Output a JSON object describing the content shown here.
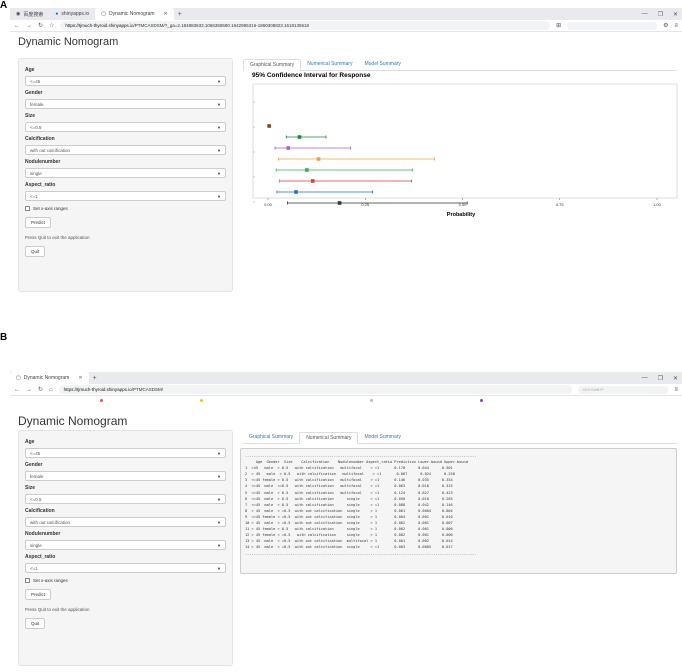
{
  "panels": {
    "a": "A",
    "b": "B"
  },
  "browser_a": {
    "tabs": [
      {
        "label": "百度搜索"
      },
      {
        "label": "shinyapps.io"
      },
      {
        "label": "Dynamic Nomogram"
      }
    ],
    "url_host": "https://tjmuch-thyroid.shinyapps.io",
    "url_path": "/PTMCASDSM/?_ga=2.184883633.1066359580.1642995316-1860308823.1618135618"
  },
  "browser_b": {
    "tabs": [
      {
        "label": "Dynamic Nomogram"
      }
    ],
    "url_host": "https://tjmuch-thyroid.shinyapps.io",
    "url_path": "/PTMCASDSM/",
    "search_placeholder": "Ctrl+Shift+F"
  },
  "app": {
    "title": "Dynamic Nomogram",
    "fields": [
      {
        "label": "Age",
        "value": "<=45"
      },
      {
        "label": "Gender",
        "value": "female"
      },
      {
        "label": "Size",
        "value": "<=0.5"
      },
      {
        "label": "Calcification",
        "value": "with out calcification"
      },
      {
        "label": "Nodulenumber",
        "value": "single"
      },
      {
        "label": "Aspect_ratio",
        "value": "<=1"
      }
    ],
    "checkbox_label": "Set x-axis ranges",
    "predict": "Predict",
    "quit_note": "Press Quit to exit the application",
    "quit": "Quit",
    "tabs": [
      "Graphical Summary",
      "Numerical Summary",
      "Model Summary"
    ]
  },
  "chart_data": {
    "type": "scatter",
    "title": "95% Confidence Interval for Response",
    "xlabel": "Probability",
    "xlim": [
      0,
      1
    ],
    "xticks": [
      "0.00",
      "0.25",
      "0.50",
      "0.75",
      "1.00"
    ],
    "colors": [
      "#8b4513",
      "#1a8a3a",
      "#b05cc8",
      "#f0a040",
      "#33b050",
      "#e03a3a",
      "#1f6fd0",
      "#333333"
    ],
    "series": [
      {
        "y": 1,
        "est": 0.003,
        "lo": 0.003,
        "hi": 0.003
      },
      {
        "y": 2,
        "est": 0.081,
        "lo": 0.047,
        "hi": 0.149
      },
      {
        "y": 3,
        "est": 0.052,
        "lo": 0.018,
        "hi": 0.212
      },
      {
        "y": 4,
        "est": 0.13,
        "lo": 0.027,
        "hi": 0.428
      },
      {
        "y": 5,
        "est": 0.1,
        "lo": 0.021,
        "hi": 0.371
      },
      {
        "y": 6,
        "est": 0.115,
        "lo": 0.03,
        "hi": 0.369
      },
      {
        "y": 7,
        "est": 0.072,
        "lo": 0.023,
        "hi": 0.269
      },
      {
        "y": 8,
        "est": 0.184,
        "lo": 0.05,
        "hi": 0.512
      }
    ]
  },
  "table": {
    "divider": "-----------------------------------------------------------------------------------------------------------",
    "header": "     Age  Gender  Size    Calcification    Nodulenumber Aspect_ratio Prediction Lower.bound Upper.bound",
    "rows": [
      "1  >45   male  > 0.5   with calcification   multifocal    > =1       0.170      0.044      0.501",
      "2  > 45   male  > 0.5   with calcification   multifocal    > =1       0.067      0.024      0.258",
      "3  <=45 female > 0.5   with calcification   multifocal    > =1       0.146      0.035      0.354",
      "4  <=45  male  <=0.5   with calcification   multifocal    > =1       0.063      0.018      0.315",
      "5  <=45  male  > 0.5   with calcification   multifocal    > =1       0.124      0.027      0.423",
      "6  <=45  male  > 0.5   with calcification      single     > =1       0.050      0.010      0.265",
      "7  <=45  male  > 0.5   with calcification      single     > =1       0.088      0.042      0.146",
      "8  > 45  male  < =0.5  with out calcification  single     > 1        0.001      0.0004     0.004",
      "9  <=45 female < =0.5  with out calcification  single     > 1        0.004      0.001      0.010",
      "10 > 45  male  < =0.5  with out calcification  single     > 1        0.002      0.001      0.007",
      "11 > 45 female > 0.5   with calcification      single     > 1        0.002      0.001      0.006",
      "12 > 45 female < =0.5   with calcification     single     > 1        0.002      0.001      0.006",
      "13 > 45  male  < =0.5  with out calcification  multifocal > 1        0.001      0.002      0.014",
      "14 > 45  male  < =0.5  with out calcification  single     > =1       0.003      0.0005     0.017"
    ]
  }
}
